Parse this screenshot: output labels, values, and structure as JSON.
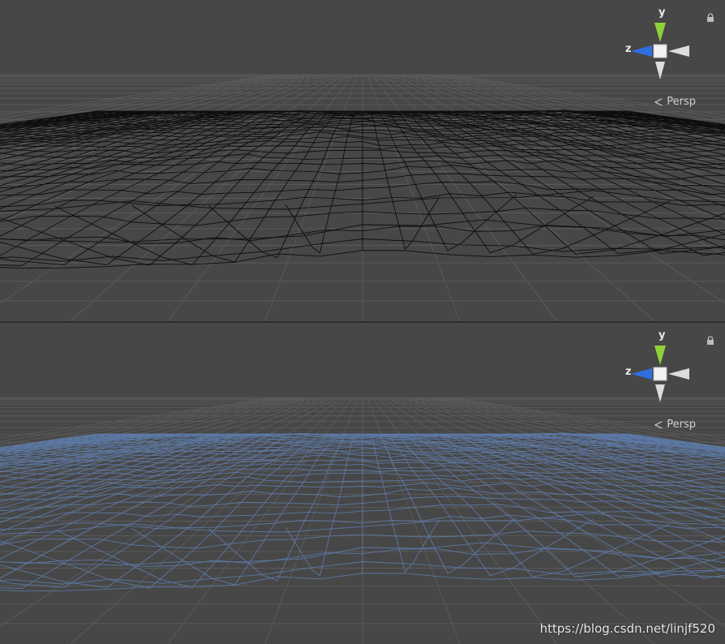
{
  "viewports": [
    {
      "id": "top",
      "render_mode": "wireframe",
      "mesh_color": "#0a0a0a",
      "gizmo": {
        "y_label": "y",
        "z_label": "z"
      },
      "projection_label": "Persp"
    },
    {
      "id": "bottom",
      "render_mode": "shaded-wireframe",
      "mesh_color": "#5f80b4",
      "gizmo": {
        "y_label": "y",
        "z_label": "z"
      },
      "projection_label": "Persp"
    }
  ],
  "colors": {
    "background": "#474747",
    "grid": "#5a5a5a",
    "gizmo_y": "#8fd13a",
    "gizmo_z": "#2f6fe0",
    "gizmo_neutral": "#dcdcdc"
  },
  "icons": {
    "lock": "lock-icon",
    "chevron": "chevron-left-icon"
  },
  "watermark": "https://blog.csdn.net/linjf520"
}
